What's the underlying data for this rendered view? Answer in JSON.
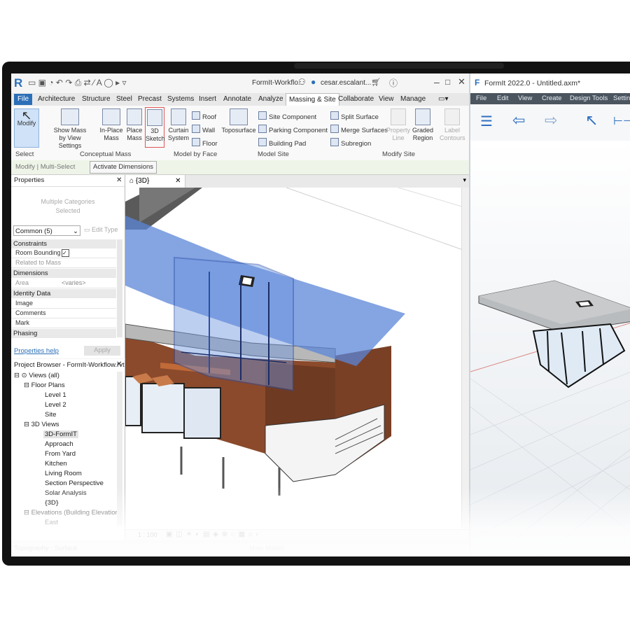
{
  "revit": {
    "title": "FormIt-Workflo...",
    "user": "cesar.escalant...",
    "tabs": [
      "File",
      "Architecture",
      "Structure",
      "Steel",
      "Precast",
      "Systems",
      "Insert",
      "Annotate",
      "Analyze",
      "Massing & Site",
      "Collaborate",
      "View",
      "Manage"
    ],
    "active_tab": "Massing & Site",
    "ribbon": {
      "modify": "Modify",
      "select": "Select",
      "show_mass_1": "Show Mass",
      "show_mass_2": "by View Settings",
      "inplace_1": "In-Place",
      "inplace_2": "Mass",
      "place_1": "Place",
      "place_2": "Mass",
      "sketch_1": "3D",
      "sketch_2": "Sketch",
      "curtain_1": "Curtain",
      "curtain_2": "System",
      "roof": "Roof",
      "wall": "Wall",
      "floor": "Floor",
      "toposurface": "Toposurface",
      "site_component": "Site  Component",
      "parking_component": "Parking  Component",
      "building_pad": "Building  Pad",
      "split_surface": "Split  Surface",
      "merge_surfaces": "Merge  Surfaces",
      "subregion": "Subregion",
      "property_1": "Property",
      "property_2": "Line",
      "graded_1": "Graded",
      "graded_2": "Region",
      "label_1": "Label",
      "label_2": "Contours",
      "group_conceptual": "Conceptual Mass",
      "group_model_face": "Model by Face",
      "group_model_site": "Model Site",
      "group_modify_site": "Modify Site"
    },
    "options_bar": {
      "context": "Modify | Multi-Select",
      "activate_dimensions": "Activate Dimensions"
    },
    "properties": {
      "title": "Properties",
      "type_1": "Multiple Categories",
      "type_2": "Selected",
      "filter": "Common (5)",
      "edit_type": "Edit Type",
      "sections": [
        "Constraints",
        "Dimensions",
        "Identity Data",
        "Phasing"
      ],
      "room_bounding": "Room Bounding",
      "related_to_mass": "Related to Mass",
      "area": "Area",
      "area_value": "<varies>",
      "image": "Image",
      "comments": "Comments",
      "mark": "Mark",
      "help_link": "Properties help",
      "apply": "Apply"
    },
    "browser": {
      "title": "Project Browser - FormIt-Workflow.rvt",
      "views_all": "Views (all)",
      "floor_plans": "Floor Plans",
      "level1": "Level 1",
      "level2": "Level 2",
      "site": "Site",
      "views3d": "3D Views",
      "v_formit": "3D-FormIT",
      "v_approach": "Approach",
      "v_yard": "From Yard",
      "v_kitchen": "Kitchen",
      "v_living": "Living Room",
      "v_section": "Section Perspective",
      "v_solar": "Solar Analysis",
      "v_3d": "{3D}",
      "elevations": "Elevations (Building Elevation",
      "east": "East"
    },
    "view_tab": "{3D}",
    "scale": "1 : 100",
    "status": "Topography : Surface",
    "main_model": "Main Model"
  },
  "formit": {
    "title": "FormIt 2022.0 - Untitled.axm*",
    "menu": [
      "File",
      "Edit",
      "View",
      "Create",
      "Design Tools",
      "Settin"
    ]
  }
}
